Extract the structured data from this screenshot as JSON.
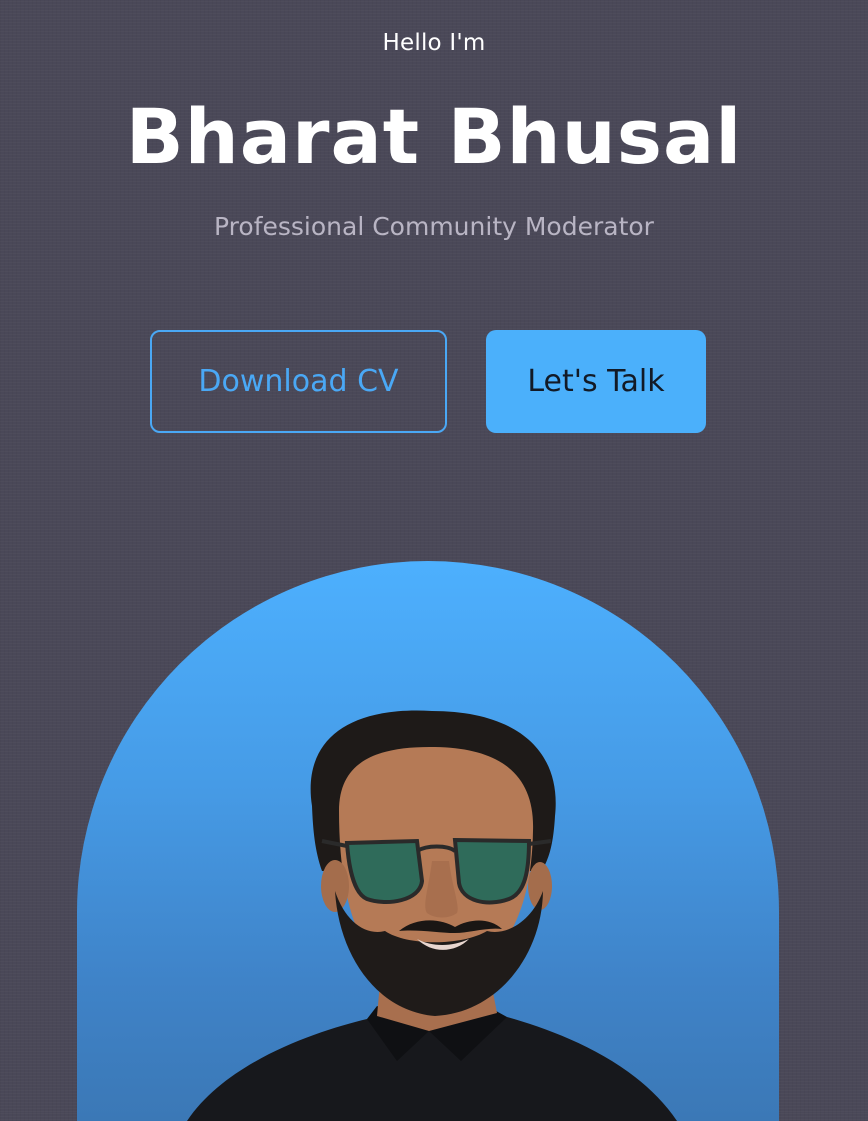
{
  "hero": {
    "greeting": "Hello I'm",
    "name": "Bharat Bhusal",
    "role": "Professional Community Moderator"
  },
  "actions": {
    "download_label": "Download CV",
    "talk_label": "Let's Talk"
  },
  "colors": {
    "background": "#4a4858",
    "accent": "#4bb0fb",
    "subtitle": "#b9b5c4"
  },
  "portrait": {
    "icon": "person-photo"
  }
}
